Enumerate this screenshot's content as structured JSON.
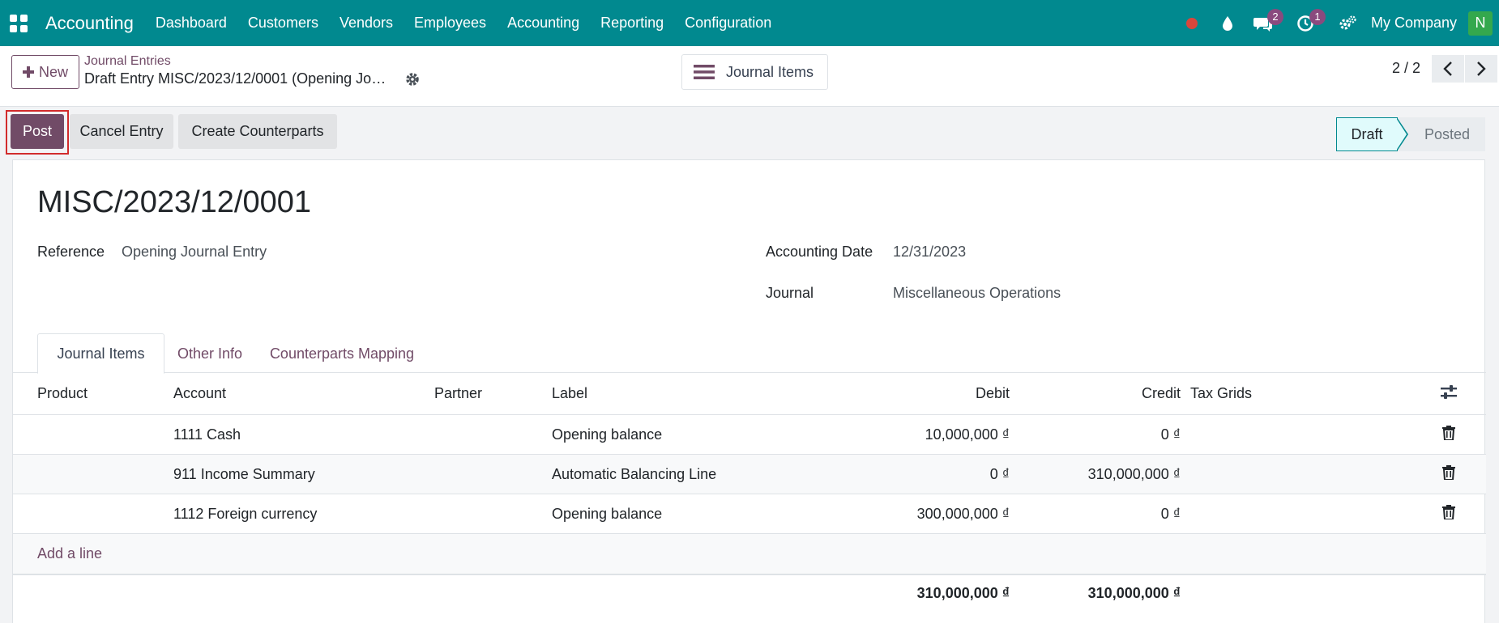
{
  "app": {
    "brand": "Accounting",
    "menu": [
      "Dashboard",
      "Customers",
      "Vendors",
      "Employees",
      "Accounting",
      "Reporting",
      "Configuration"
    ],
    "messages_count": "2",
    "activities_count": "1",
    "company": "My Company",
    "avatar_initial": "N"
  },
  "control": {
    "new_label": "New",
    "breadcrumb_parent": "Journal Entries",
    "breadcrumb_current": "Draft Entry MISC/2023/12/0001 (Opening Jo…",
    "journal_items_button": "Journal Items",
    "pager": "2 / 2"
  },
  "statusbar": {
    "post": "Post",
    "cancel": "Cancel Entry",
    "counterparts": "Create Counterparts",
    "stage_draft": "Draft",
    "stage_posted": "Posted"
  },
  "form": {
    "title": "MISC/2023/12/0001",
    "reference_label": "Reference",
    "reference_value": "Opening Journal Entry",
    "date_label": "Accounting Date",
    "date_value": "12/31/2023",
    "journal_label": "Journal",
    "journal_value": "Miscellaneous Operations"
  },
  "tabs": [
    "Journal Items",
    "Other Info",
    "Counterparts Mapping"
  ],
  "table": {
    "headers": {
      "product": "Product",
      "account": "Account",
      "partner": "Partner",
      "label": "Label",
      "debit": "Debit",
      "credit": "Credit",
      "tax_grids": "Tax Grids"
    },
    "rows": [
      {
        "account": "1111 Cash",
        "label": "Opening balance",
        "debit": "10,000,000 ₫",
        "credit": "0 ₫"
      },
      {
        "account": "911 Income Summary",
        "label": "Automatic Balancing Line",
        "debit": "0 ₫",
        "credit": "310,000,000 ₫"
      },
      {
        "account": "1112 Foreign currency",
        "label": "Opening balance",
        "debit": "300,000,000 ₫",
        "credit": "0 ₫"
      }
    ],
    "add_line": "Add a line",
    "total_debit": "310,000,000 ₫",
    "total_credit": "310,000,000 ₫"
  },
  "colors": {
    "navbar": "#01898f",
    "primary": "#714b67",
    "highlight": "#d22c2c"
  }
}
